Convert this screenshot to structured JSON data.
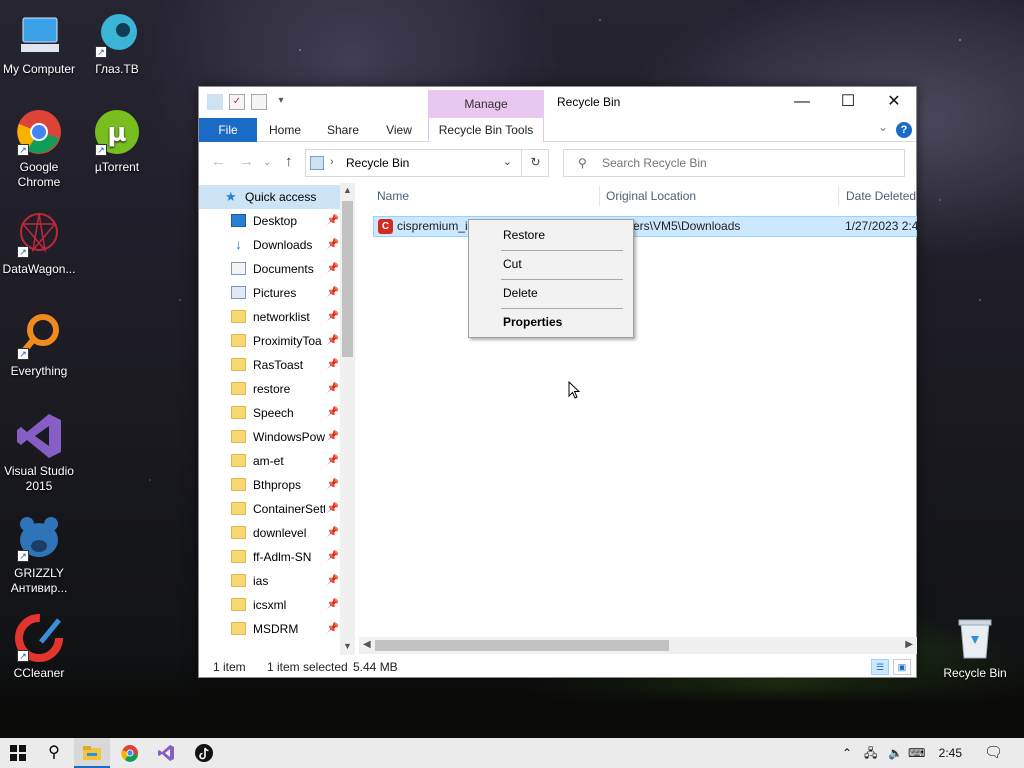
{
  "desktop": {
    "icons": [
      {
        "label": "My Computer"
      },
      {
        "label": "Глаз.ТВ"
      },
      {
        "label": "Google Chrome"
      },
      {
        "label": "µTorrent"
      },
      {
        "label": "DataWagon..."
      },
      {
        "label": "Everything"
      },
      {
        "label": "Visual Studio 2015"
      },
      {
        "label": "GRIZZLY Антивир..."
      },
      {
        "label": "CCleaner"
      },
      {
        "label": "Recycle Bin"
      }
    ]
  },
  "window": {
    "title": "Recycle Bin",
    "contextual_tab_group": "Manage",
    "ribbon_tabs": {
      "file": "File",
      "home": "Home",
      "share": "Share",
      "view": "View",
      "recycle_bin_tools": "Recycle Bin Tools"
    },
    "help_glyph": "?",
    "address": {
      "current": "Recycle Bin"
    },
    "search": {
      "placeholder": "Search Recycle Bin"
    },
    "nav": {
      "quick_access": "Quick access",
      "items": [
        {
          "label": "Desktop",
          "icon": "desktop-icon"
        },
        {
          "label": "Downloads",
          "icon": "downloads-icon"
        },
        {
          "label": "Documents",
          "icon": "documents-icon"
        },
        {
          "label": "Pictures",
          "icon": "pictures-icon"
        },
        {
          "label": "networklist",
          "icon": "folder-icon"
        },
        {
          "label": "ProximityToa",
          "icon": "folder-icon"
        },
        {
          "label": "RasToast",
          "icon": "folder-icon"
        },
        {
          "label": "restore",
          "icon": "folder-icon"
        },
        {
          "label": "Speech",
          "icon": "folder-icon"
        },
        {
          "label": "WindowsPow",
          "icon": "folder-icon"
        },
        {
          "label": "am-et",
          "icon": "folder-icon"
        },
        {
          "label": "Bthprops",
          "icon": "folder-icon"
        },
        {
          "label": "ContainerSett",
          "icon": "folder-icon"
        },
        {
          "label": "downlevel",
          "icon": "folder-icon"
        },
        {
          "label": "ff-Adlm-SN",
          "icon": "folder-icon"
        },
        {
          "label": "ias",
          "icon": "folder-icon"
        },
        {
          "label": "icsxml",
          "icon": "folder-icon"
        },
        {
          "label": "MSDRM",
          "icon": "folder-icon"
        }
      ]
    },
    "columns": {
      "name": "Name",
      "original_location": "Original Location",
      "date_deleted": "Date Deleted"
    },
    "rows": [
      {
        "name": "cispremium_i",
        "original_location": "ers\\VM5\\Downloads",
        "date_deleted": "1/27/2023 2:4"
      }
    ],
    "status": {
      "count": "1 item",
      "selected": "1 item selected",
      "size": "5.44 MB"
    }
  },
  "context_menu": {
    "items": [
      "Restore",
      "Cut",
      "Delete",
      "Properties"
    ]
  },
  "taskbar": {
    "time": "2:45 AM"
  },
  "colors": {
    "accent": "#1a6bc6",
    "manage_tab": "#e8c8f0",
    "selection": "#cce8ff"
  }
}
